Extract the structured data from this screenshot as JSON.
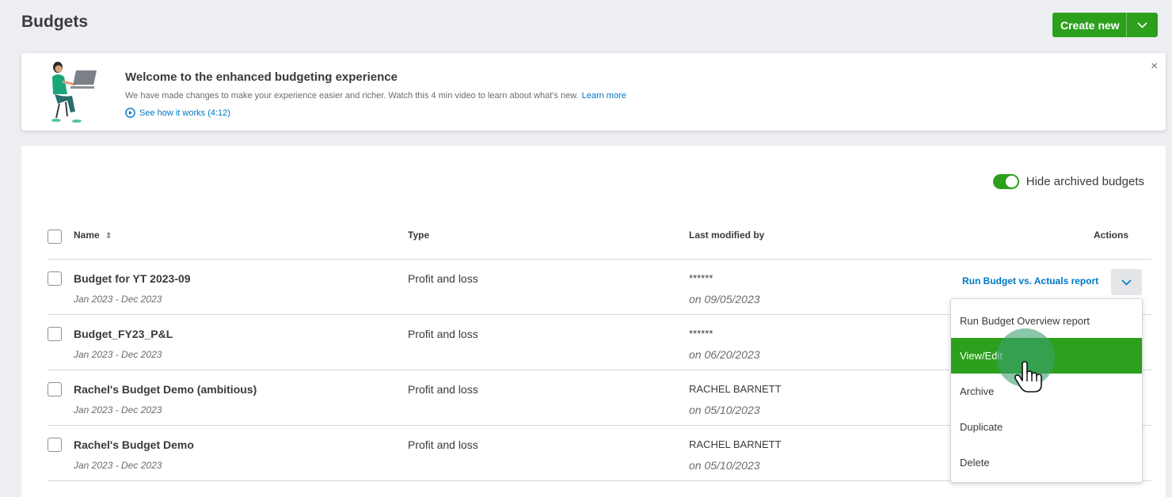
{
  "page": {
    "title": "Budgets",
    "create_new_label": "Create new"
  },
  "banner": {
    "title": "Welcome to the enhanced budgeting experience",
    "text": "We have made changes to make your experience easier and richer. Watch this 4 min video to learn about what's new.",
    "learn_more": "Learn more",
    "video_link": "See how it works (4:12)",
    "close": "×"
  },
  "toolbar": {
    "toggle_label": "Hide archived budgets",
    "toggle_on": true
  },
  "table": {
    "headers": {
      "name": "Name",
      "sort_icon": "⇕",
      "type": "Type",
      "modified": "Last modified by",
      "actions": "Actions"
    },
    "rows": [
      {
        "name": "Budget for YT 2023-09",
        "range": "Jan 2023 - Dec 2023",
        "type": "Profit and loss",
        "modified_by": "******",
        "modified_on": "on 09/05/2023",
        "action": "Run Budget vs. Actuals report"
      },
      {
        "name": "Budget_FY23_P&L",
        "range": "Jan 2023 - Dec 2023",
        "type": "Profit and loss",
        "modified_by": "******",
        "modified_on": "on 06/20/2023"
      },
      {
        "name": "Rachel's Budget Demo (ambitious)",
        "range": "Jan 2023 - Dec 2023",
        "type": "Profit and loss",
        "modified_by": "RACHEL BARNETT",
        "modified_on": "on 05/10/2023"
      },
      {
        "name": "Rachel's Budget Demo",
        "range": "Jan 2023 - Dec 2023",
        "type": "Profit and loss",
        "modified_by": "RACHEL BARNETT",
        "modified_on": "on 05/10/2023"
      }
    ]
  },
  "menu": {
    "items": [
      {
        "label": "Run Budget Overview report"
      },
      {
        "label": "View/Edit",
        "active": true
      },
      {
        "label": "Archive"
      },
      {
        "label": "Duplicate"
      },
      {
        "label": "Delete"
      }
    ]
  },
  "colors": {
    "brand_green": "#2ca01c",
    "link_blue": "#0077c5",
    "page_bg": "#eceef1"
  },
  "icons": [
    "chevron-down-icon",
    "close-icon",
    "play-circle-icon",
    "sort-icon",
    "hand-pointer-icon"
  ]
}
